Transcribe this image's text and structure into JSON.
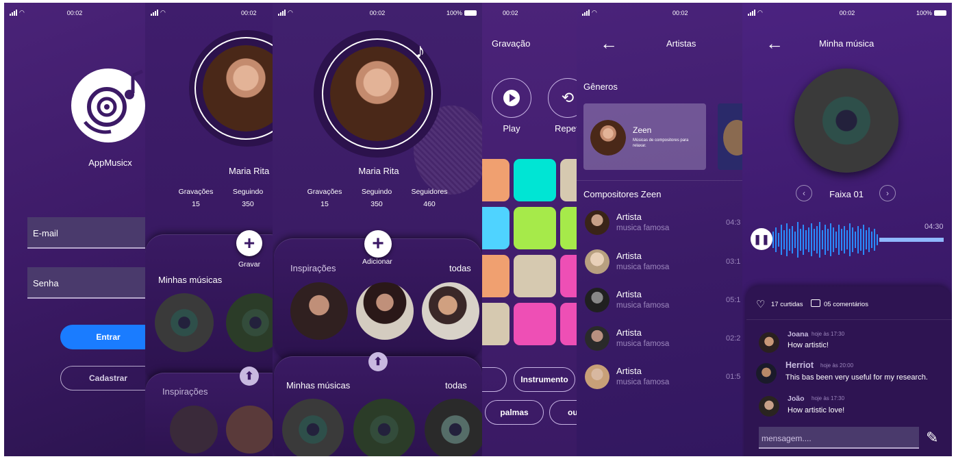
{
  "status": {
    "time": "00:02",
    "battery": "100%"
  },
  "login": {
    "app_name": "AppMusicx",
    "email_placeholder": "E-mail",
    "password_placeholder": "Senha",
    "login_button": "Entrar",
    "register_button": "Cadastrar"
  },
  "profile1": {
    "name": "Maria Rita",
    "stats": [
      {
        "label": "Gravações",
        "value": "15"
      },
      {
        "label": "Seguindo",
        "value": "350"
      }
    ],
    "record_label": "Gravar",
    "my_songs": "Minhas músicas",
    "inspirations": "Inspirações"
  },
  "profile2": {
    "name": "Maria Rita",
    "stats": [
      {
        "label": "Gravações",
        "value": "15"
      },
      {
        "label": "Seguindo",
        "value": "350"
      },
      {
        "label": "Seguidores",
        "value": "460"
      }
    ],
    "add_label": "Adicionar",
    "inspirations": "Inspirações",
    "all": "todas",
    "my_songs": "Minhas músicas",
    "all2": "todas"
  },
  "recording": {
    "title": "Gravação",
    "play": "Play",
    "repeat": "Repet",
    "chips": [
      "Instrumento",
      "palmas",
      "ou"
    ]
  },
  "artists": {
    "title": "Artistas",
    "genres": "Gêneros",
    "genre_card": {
      "name": "Zeen",
      "desc": "Músicas de compositores para relaxar."
    },
    "composers": "Compositores Zeen",
    "list": [
      {
        "name": "Artista",
        "sub": "musica famosa",
        "duration": "04:3"
      },
      {
        "name": "Artista",
        "sub": "musica famosa",
        "duration": "03:1"
      },
      {
        "name": "Artista",
        "sub": "musica famosa",
        "duration": "05:1"
      },
      {
        "name": "Artista",
        "sub": "musica famosa",
        "duration": "02:2"
      },
      {
        "name": "Artista",
        "sub": "musica famosa",
        "duration": "01:5"
      }
    ]
  },
  "player": {
    "title": "Minha música",
    "track": "Faixa 01",
    "time": "04:30",
    "likes": "17 curtidas",
    "comments_count": "05 comentários",
    "comments": [
      {
        "user": "Joana",
        "when": "hoje às 17:30",
        "text": "How artistic!"
      },
      {
        "user": "Herriot",
        "when": "hoje às 20:00",
        "text": "This bas been very useful for my research."
      },
      {
        "user": "João",
        "when": "hoje às 17:30",
        "text": "How artistic love!"
      }
    ],
    "message_placeholder": "mensagem...."
  },
  "colors": {
    "bg": "#3b1a66",
    "accent_blue": "#1a7cff",
    "pads": [
      "#f0a070",
      "#00e5d4",
      "#d6c9b0",
      "#4fd3ff",
      "#a6ea4a",
      "#ee4fb5"
    ]
  }
}
